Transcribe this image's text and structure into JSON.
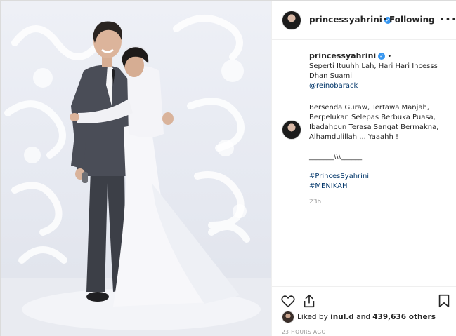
{
  "post": {
    "username": "princessyahrini",
    "header_separator": "•",
    "follow_status": "Following",
    "more_label": "•••"
  },
  "caption": {
    "username": "princessyahrini",
    "separator": "•",
    "line1": "Seperti Ituuhh Lah, Hari Hari Incesss",
    "line2": "Dhan Suami",
    "mention": "@reinobarack"
  },
  "comment": {
    "line1": "Bersenda Guraw, Tertawa Manjah,",
    "line2": "Berpelukan Selepas Berbuka Puasa,",
    "line3": "Ibadahpun Terasa Sangat Bermakna,",
    "line4": "Alhamdulillah ... Yaaahh !",
    "divider": "_______\\\\\\______",
    "hashtag1": "#PrincesSyahrini",
    "hashtag2": "#MENIKAH",
    "time": "23h"
  },
  "likes": {
    "prefix": "Liked by ",
    "user": "inul.d",
    "middle": " and ",
    "count": "439,636 others"
  },
  "timestamp": "23 HOURS AGO",
  "icons": {
    "like": "heart-icon",
    "share": "share-icon",
    "save": "bookmark-icon",
    "verified": "verified-badge-icon"
  },
  "colors": {
    "link": "#003569",
    "verified": "#3897f0",
    "muted": "#999999"
  }
}
